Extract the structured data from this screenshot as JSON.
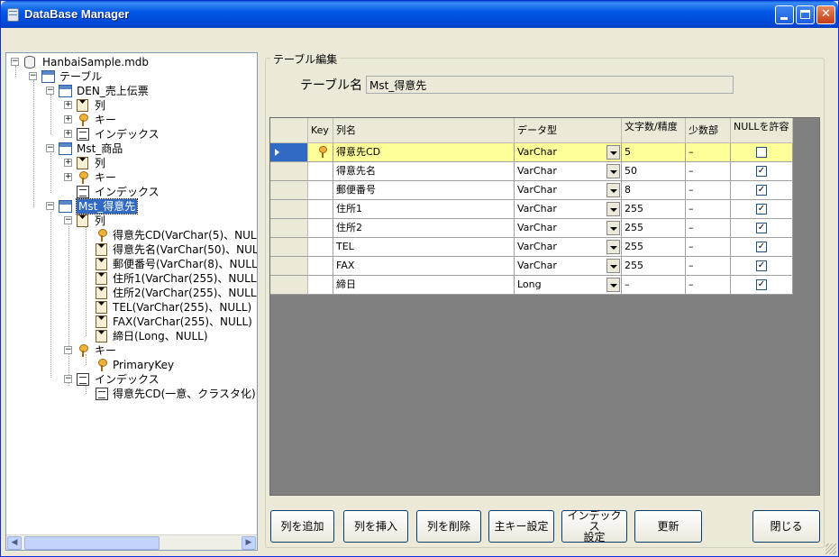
{
  "window": {
    "title": "DataBase Manager"
  },
  "tree": {
    "root": "HanbaiSample.mdb",
    "tables_node": "テーブル",
    "den_table": "DEN_売上伝票",
    "den_columns": "列",
    "den_keys": "キー",
    "den_indexes": "インデックス",
    "mst_shohin": "Mst_商品",
    "shohin_columns": "列",
    "shohin_keys": "キー",
    "shohin_indexes": "インデックス",
    "mst_tokuisaki": "Mst_得意先",
    "tokui_columns": "列",
    "columns": [
      "得意先CD(VarChar(5)、NULL",
      "得意先名(VarChar(50)、NULL",
      "郵便番号(VarChar(8)、NULL)",
      "住所1(VarChar(255)、NULL)",
      "住所2(VarChar(255)、NULL)",
      "TEL(VarChar(255)、NULL)",
      "FAX(VarChar(255)、NULL)",
      "締日(Long、NULL)"
    ],
    "tokui_keys": "キー",
    "primary_key": "PrimaryKey",
    "tokui_indexes": "インデックス",
    "index_item": "得意先CD(一意、クラスタ化)"
  },
  "editor": {
    "group_title": "テーブル編集",
    "table_name_label": "テーブル名",
    "table_name_value": "Mst_得意先"
  },
  "grid": {
    "headers": {
      "key": "Key",
      "name": "列名",
      "type": "データ型",
      "length": "文字数/精度",
      "scale": "少数部",
      "nullable": "NULLを許容"
    },
    "rows": [
      {
        "name": "得意先CD",
        "type": "VarChar",
        "length": "5",
        "scale": "–",
        "nullable": "☐",
        "key": true
      },
      {
        "name": "得意先名",
        "type": "VarChar",
        "length": "50",
        "scale": "–",
        "nullable": "✓",
        "key": false
      },
      {
        "name": "郵便番号",
        "type": "VarChar",
        "length": "8",
        "scale": "–",
        "nullable": "✓",
        "key": false
      },
      {
        "name": "住所1",
        "type": "VarChar",
        "length": "255",
        "scale": "–",
        "nullable": "✓",
        "key": false
      },
      {
        "name": "住所2",
        "type": "VarChar",
        "length": "255",
        "scale": "–",
        "nullable": "✓",
        "key": false
      },
      {
        "name": "TEL",
        "type": "VarChar",
        "length": "255",
        "scale": "–",
        "nullable": "✓",
        "key": false
      },
      {
        "name": "FAX",
        "type": "VarChar",
        "length": "255",
        "scale": "–",
        "nullable": "✓",
        "key": false
      },
      {
        "name": "締日",
        "type": "Long",
        "length": "–",
        "scale": "–",
        "nullable": "✓",
        "key": false
      }
    ]
  },
  "buttons": {
    "add_column": "列を追加",
    "insert_column": "列を挿入",
    "delete_column": "列を削除",
    "set_primary_key": "主キー設定",
    "set_index_line1": "インデックス",
    "set_index_line2": "設定",
    "update": "更新",
    "close": "閉じる"
  }
}
